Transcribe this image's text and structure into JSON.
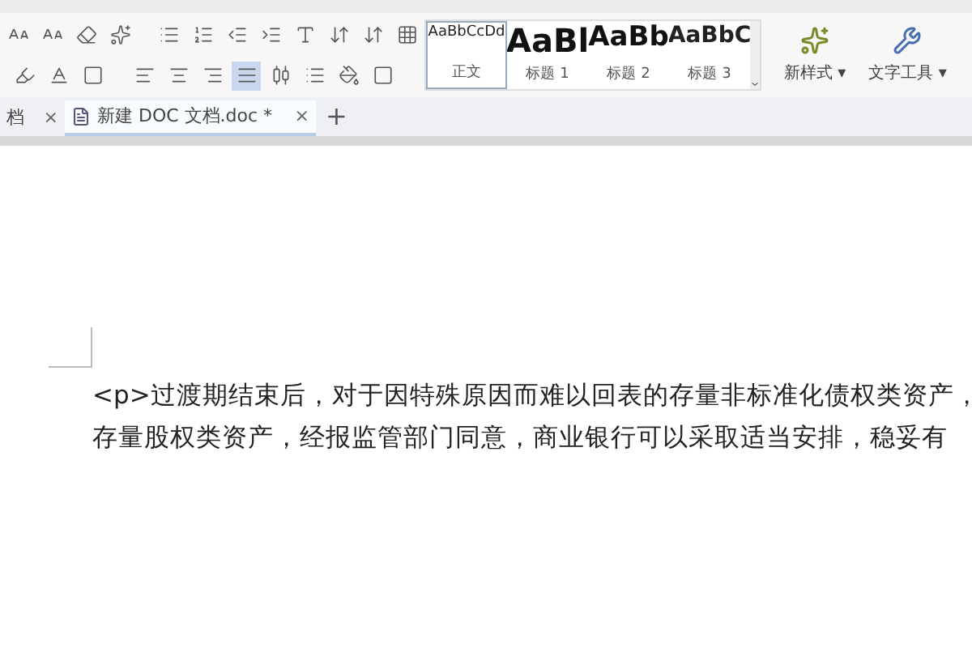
{
  "styles": [
    {
      "sample": "AaBbCcDd",
      "label": "正文",
      "selected": true,
      "kind": "body"
    },
    {
      "sample": "AaBl",
      "label": "标题 1",
      "selected": false,
      "kind": "h1"
    },
    {
      "sample": "AaBb",
      "label": "标题 2",
      "selected": false,
      "kind": "h2"
    },
    {
      "sample": "AaBbC",
      "label": "标题 3",
      "selected": false,
      "kind": "h3"
    }
  ],
  "tools": [
    {
      "label": "新样式 ▾",
      "kind": "new-style"
    },
    {
      "label": "文字工具 ▾",
      "kind": "text-tools"
    }
  ],
  "doc_tabs": [
    {
      "label": "档",
      "close": "×",
      "selected": false
    },
    {
      "label": "新建 DOC 文档.doc *",
      "close": "×",
      "selected": true
    }
  ],
  "new_tab": "+",
  "paragraph_lines": [
    "<p>过渡期结束后，对于因特殊原因而难以回表的存量非标准化债权类资产，",
    "存量股权类资产，经报监管部门同意，商业银行可以采取适当安排，稳妥有"
  ]
}
